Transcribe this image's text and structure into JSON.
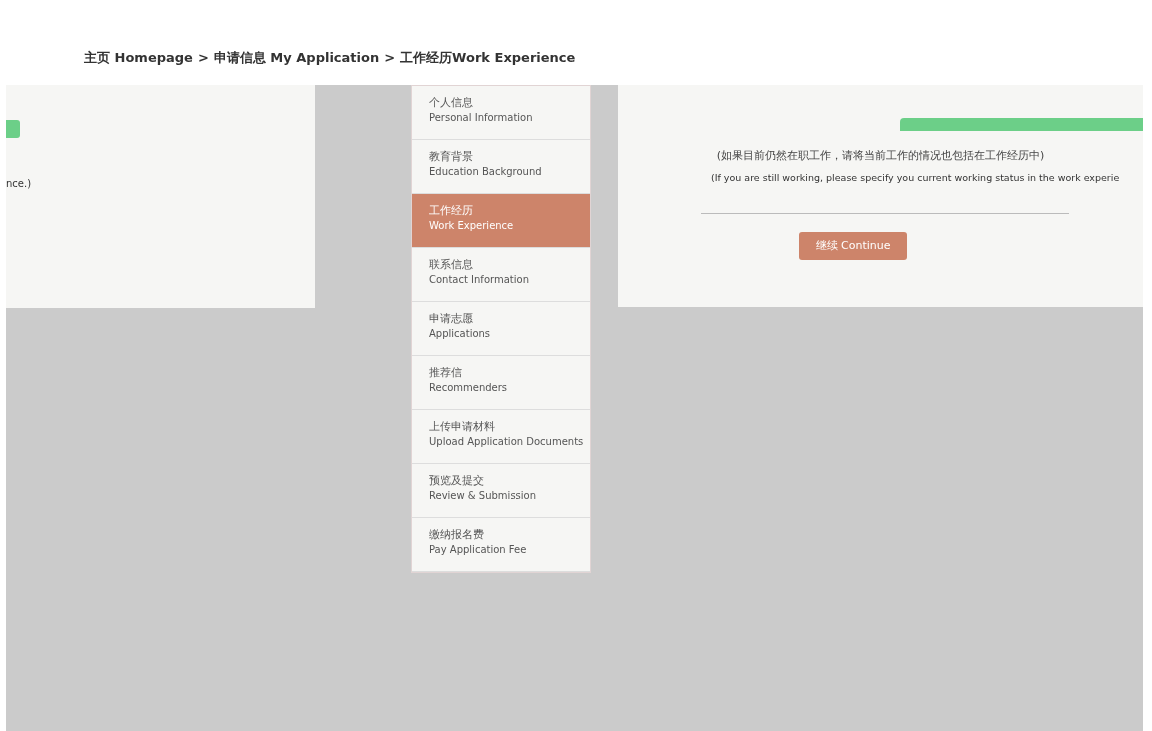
{
  "breadcrumb_separator": ">",
  "breadcrumb": [
    {
      "label": "主页 Homepage"
    },
    {
      "label": "申请信息 My Application"
    },
    {
      "label": "工作经历Work Experience"
    }
  ],
  "left_panel": {
    "note": "nce.)"
  },
  "sidebar": {
    "items": [
      {
        "title": "个人信息",
        "subtitle": "Personal Information",
        "selected": false
      },
      {
        "title": "教育背景",
        "subtitle": "Education Background",
        "selected": false
      },
      {
        "title": "工作经历",
        "subtitle": "Work Experience",
        "selected": true
      },
      {
        "title": "联系信息",
        "subtitle": "Contact Information",
        "selected": false
      },
      {
        "title": "申请志愿",
        "subtitle": "Applications",
        "selected": false
      },
      {
        "title": "推荐信",
        "subtitle": "Recommenders",
        "selected": false
      },
      {
        "title": "上传申请材料",
        "subtitle": "Upload Application Documents",
        "selected": false
      },
      {
        "title": "预览及提交",
        "subtitle": "Review & Submission",
        "selected": false
      },
      {
        "title": "缴纳报名费",
        "subtitle": "Pay Application Fee",
        "selected": false
      }
    ]
  },
  "main": {
    "note_zh": "(如果目前仍然在职工作，请将当前工作的情况也包括在工作经历中)",
    "note_en": "(If you are still working, please specify you current working status in the work experie",
    "continue_button": "继续 Continue"
  }
}
